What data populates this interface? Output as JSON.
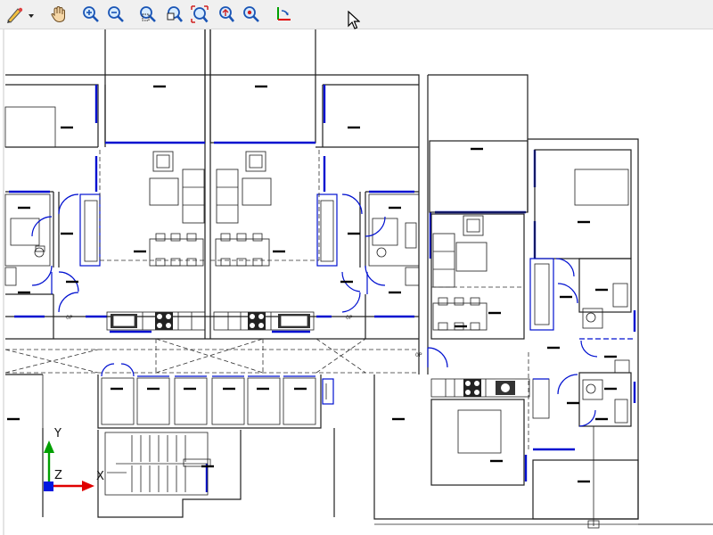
{
  "toolbar": {
    "tools": [
      {
        "icon": "edit-pencil-dropdown-icon"
      },
      {
        "icon": "pan-hand-icon"
      },
      {
        "icon": "zoom-in-icon"
      },
      {
        "icon": "zoom-out-icon"
      },
      {
        "icon": "zoom-window-icon"
      },
      {
        "icon": "zoom-previous-icon"
      },
      {
        "icon": "zoom-extents-icon"
      },
      {
        "icon": "zoom-realtime-icon"
      },
      {
        "icon": "zoom-selection-icon"
      },
      {
        "icon": "ucs-icon"
      }
    ]
  },
  "drawing": {
    "door_labels": [
      "0P",
      "0P",
      "0P"
    ],
    "ucs_axes": {
      "y": "Y",
      "x": "X",
      "z": "Z"
    },
    "colors": {
      "wall": "#202020",
      "window": "#0010d0",
      "x_axis": "#e00000",
      "y_axis": "#00a000",
      "background": "#ffffff"
    }
  }
}
